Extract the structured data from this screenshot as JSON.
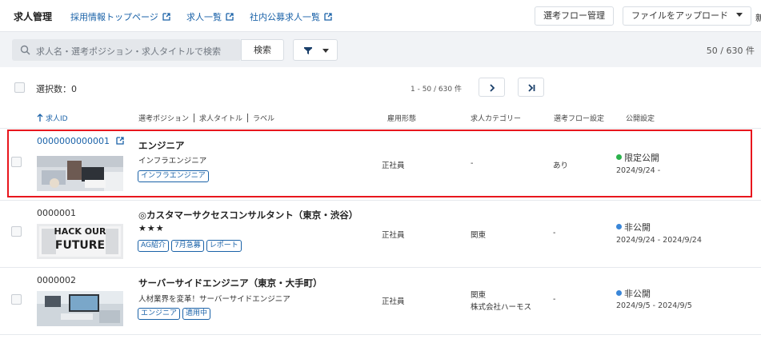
{
  "nav": {
    "title": "求人管理",
    "links": [
      "採用情報トップページ",
      "求人一覧",
      "社内公募求人一覧"
    ],
    "flow_button": "選考フロー管理",
    "upload_button": "ファイルをアップロード",
    "cut_text": "新"
  },
  "search": {
    "placeholder": "求人名・選考ポジション・求人タイトルで検索",
    "button": "検索",
    "total": "50 / 630 件"
  },
  "selection": {
    "label": "選択数：0",
    "range": "1 - 50 / 630 件"
  },
  "columns": {
    "id": "求人ID",
    "position": "選考ポジション",
    "title": "求人タイトル",
    "label": "ラベル",
    "employment": "雇用形態",
    "category": "求人カテゴリー",
    "flow": "選考フロー設定",
    "publish": "公開設定"
  },
  "rows": [
    {
      "id": "0000000000001",
      "title": "エンジニア",
      "subtitle": "インフラエンジニア",
      "tags": [
        "インフラエンジニア"
      ],
      "employment": "正社員",
      "category": "-",
      "category2": "",
      "flow": "あり",
      "status": "限定公開",
      "status_color": "#2bb24c",
      "dates": "2024/9/24 -"
    },
    {
      "id": "0000001",
      "title": "◎カスタマーサクセスコンサルタント（東京・渋谷）",
      "subtitle": "★★★",
      "tags": [
        "AG紹介",
        "7月急募",
        "レポート"
      ],
      "thumb_text_1": "HACK OUR",
      "thumb_text_2": "FUTURE",
      "employment": "正社員",
      "category": "関東",
      "category2": "",
      "flow": "-",
      "status": "非公開",
      "status_color": "#3a86d8",
      "dates": "2024/9/24 - 2024/9/24"
    },
    {
      "id": "0000002",
      "title": "サーバーサイドエンジニア（東京・大手町）",
      "subtitle": "人材業界を変革！サーバーサイドエンジニア",
      "tags": [
        "エンジニア",
        "適用中"
      ],
      "employment": "正社員",
      "category": "関東",
      "category2": "株式会社ハーモス",
      "flow": "-",
      "status": "非公開",
      "status_color": "#3a86d8",
      "dates": "2024/9/5 - 2024/9/5"
    }
  ],
  "icons": {
    "external": "external-link-icon",
    "search": "search-icon",
    "filter": "filter-icon",
    "next": "chevron-right-icon",
    "last": "last-page-icon",
    "sort": "arrow-up-icon"
  }
}
